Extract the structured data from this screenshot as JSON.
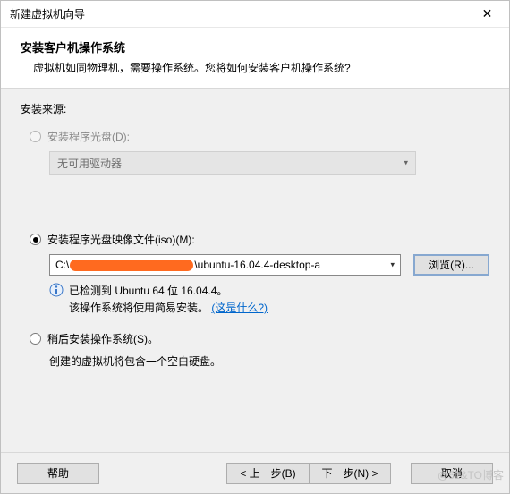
{
  "window": {
    "title": "新建虚拟机向导",
    "close_glyph": "✕"
  },
  "header": {
    "title": "安装客户机操作系统",
    "description": "虚拟机如同物理机，需要操作系统。您将如何安装客户机操作系统?"
  },
  "source_label": "安装来源:",
  "option_disc": {
    "label": "安装程序光盘(D):",
    "dropdown_text": "无可用驱动器"
  },
  "option_iso": {
    "label": "安装程序光盘映像文件(iso)(M):",
    "path_prefix": "C:\\",
    "path_visible": "\\ubuntu-16.04.4-desktop-a",
    "browse_label": "浏览(R)..."
  },
  "info": {
    "line1": "已检测到 Ubuntu 64 位 16.04.4。",
    "line2_prefix": "该操作系统将使用简易安装。",
    "link": "(这是什么?)"
  },
  "option_later": {
    "label": "稍后安装操作系统(S)。",
    "note": "创建的虚拟机将包含一个空白硬盘。"
  },
  "footer": {
    "help": "帮助",
    "back": "< 上一步(B)",
    "next": "下一步(N) >",
    "cancel": "取消"
  },
  "watermark": "@51&TO博客"
}
